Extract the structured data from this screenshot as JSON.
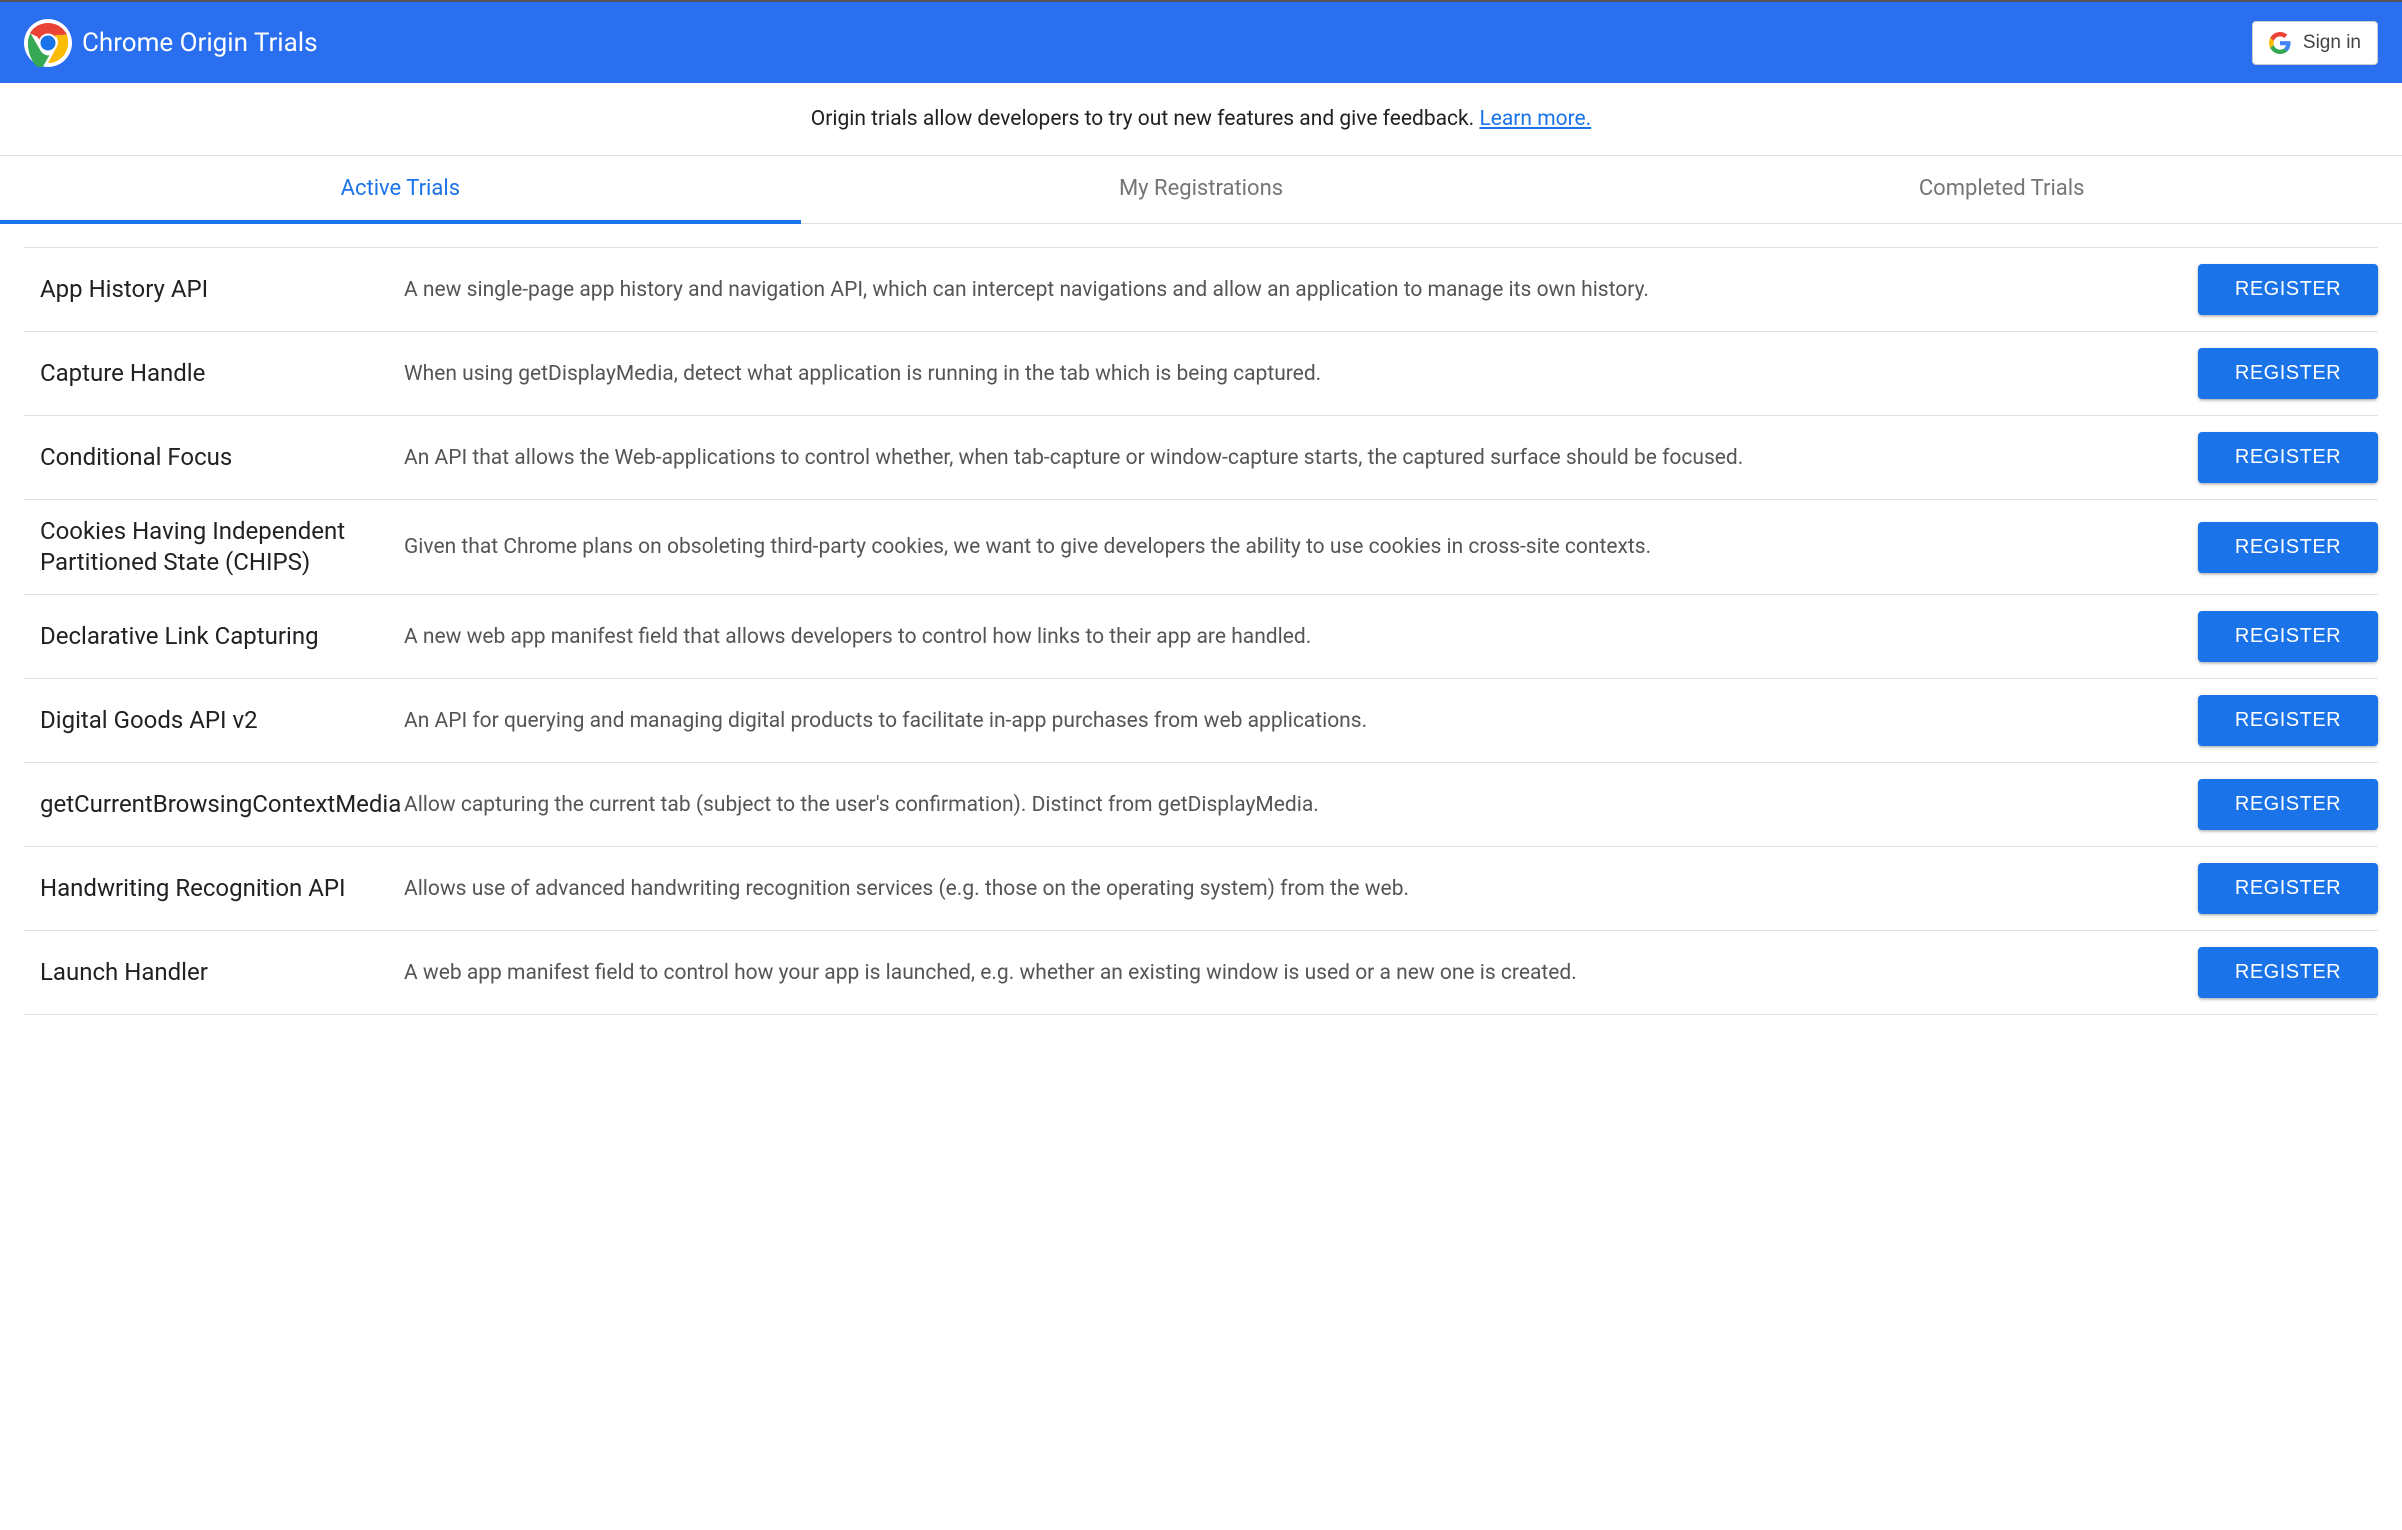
{
  "header": {
    "title": "Chrome Origin Trials",
    "signin_label": "Sign in"
  },
  "intro": {
    "text": "Origin trials allow developers to try out new features and give feedback. ",
    "link_text": "Learn more."
  },
  "tabs": [
    {
      "label": "Active Trials",
      "active": true
    },
    {
      "label": "My Registrations",
      "active": false
    },
    {
      "label": "Completed Trials",
      "active": false
    }
  ],
  "register_label": "REGISTER",
  "trials": [
    {
      "name": "App History API",
      "desc": "A new single-page app history and navigation API, which can intercept navigations and allow an application to manage its own history."
    },
    {
      "name": "Capture Handle",
      "desc": "When using getDisplayMedia, detect what application is running in the tab which is being captured."
    },
    {
      "name": "Conditional Focus",
      "desc": "An API that allows the Web-applications to control whether, when tab-capture or window-capture starts, the captured surface should be focused."
    },
    {
      "name": "Cookies Having Independent Partitioned State (CHIPS)",
      "desc": "Given that Chrome plans on obsoleting third-party cookies, we want to give developers the ability to use cookies in cross-site contexts."
    },
    {
      "name": "Declarative Link Capturing",
      "desc": "A new web app manifest field that allows developers to control how links to their app are handled."
    },
    {
      "name": "Digital Goods API v2",
      "desc": "An API for querying and managing digital products to facilitate in-app purchases from web applications."
    },
    {
      "name": "getCurrentBrowsingContextMedia",
      "desc": "Allow capturing the current tab (subject to the user's confirmation). Distinct from getDisplayMedia."
    },
    {
      "name": "Handwriting Recognition API",
      "desc": "Allows use of advanced handwriting recognition services (e.g. those on the operating system) from the web."
    },
    {
      "name": "Launch Handler",
      "desc": "A web app manifest field to control how your app is launched, e.g. whether an existing window is used or a new one is created."
    }
  ]
}
